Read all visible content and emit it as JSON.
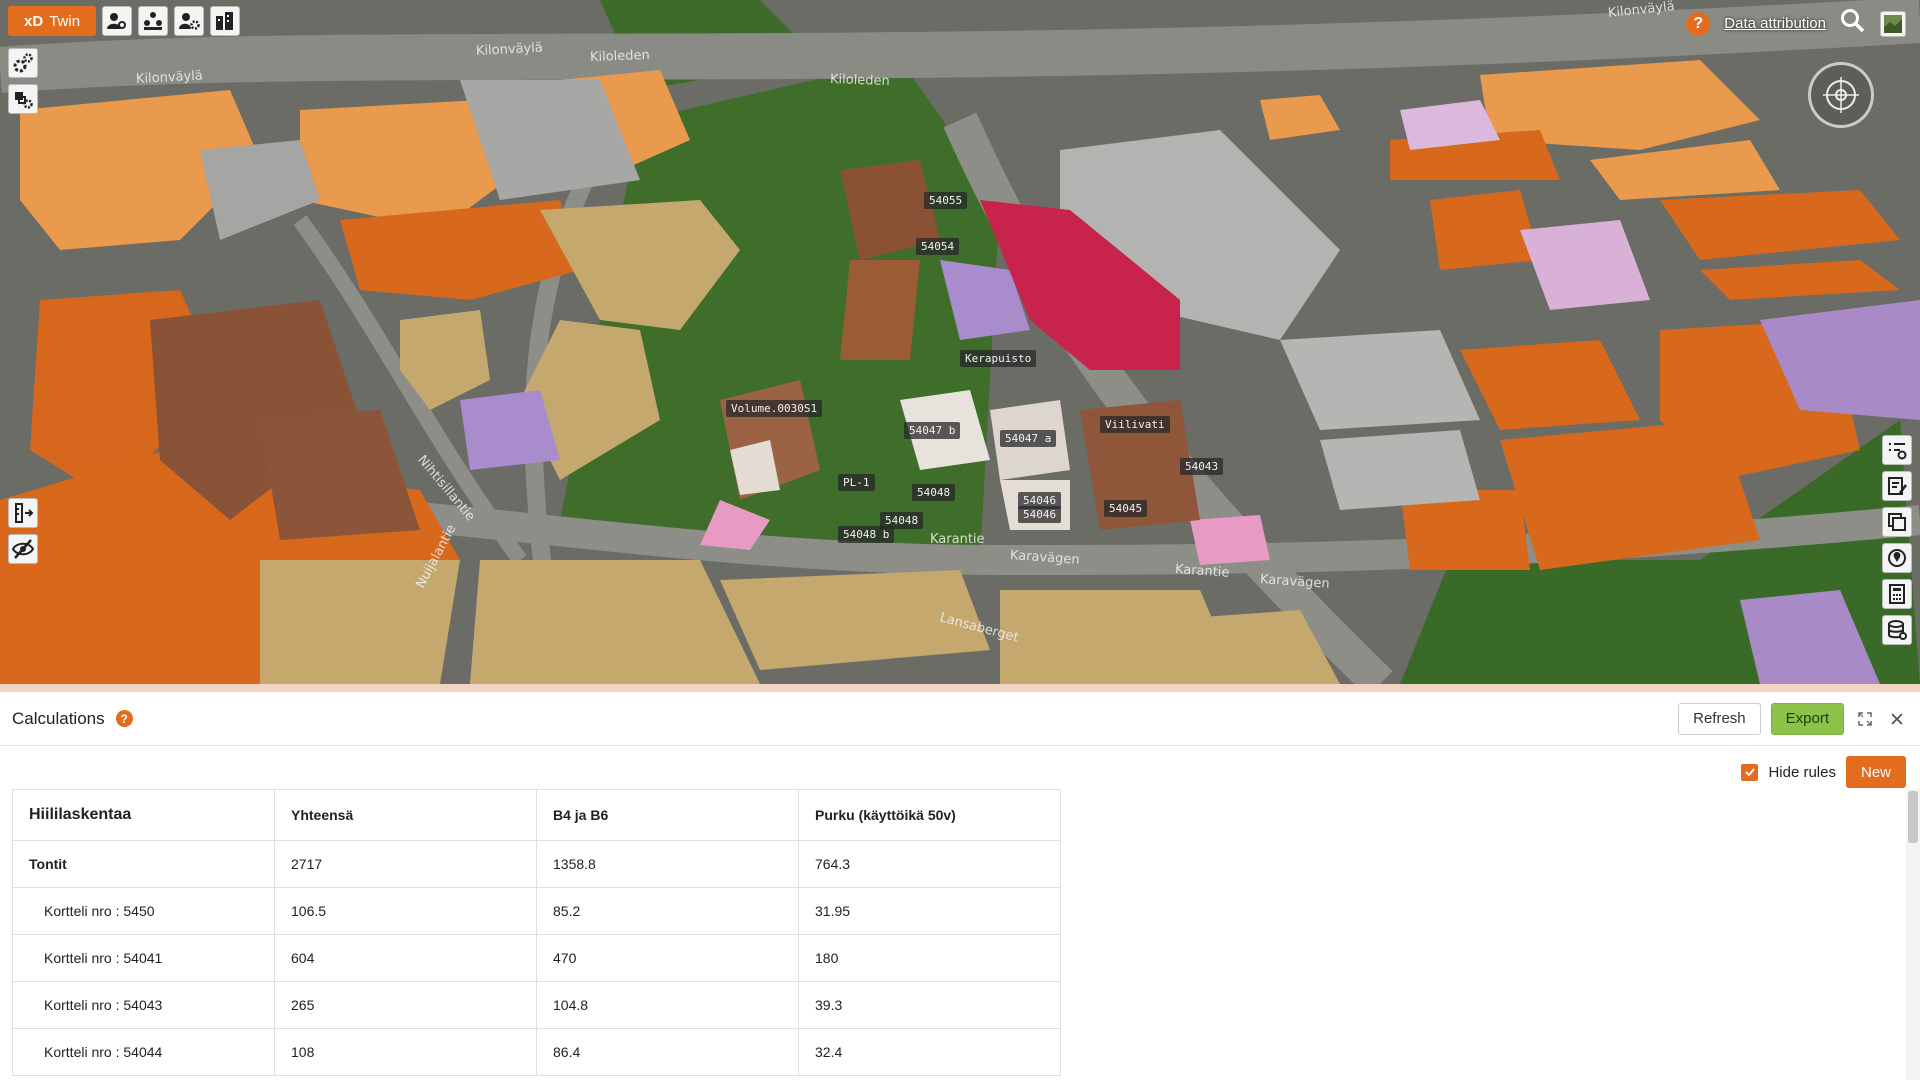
{
  "app": {
    "brand_primary": "xD",
    "brand_secondary": "Twin",
    "accent_color": "#e36c1f"
  },
  "toolbar": {
    "top_icons": [
      "users-settings-icon",
      "group-settings-icon",
      "user-gear-icon",
      "buildings-icon"
    ],
    "left_icons_top": [
      "settings-icon",
      "layers-settings-icon"
    ],
    "left_icons_mid": [
      "measure-icon",
      "visibility-off-icon"
    ],
    "right_icons": [
      "legend-list-icon",
      "notes-icon",
      "copy-layers-icon",
      "map-pin-icon",
      "calculator-icon",
      "database-icon"
    ]
  },
  "header_right": {
    "help": "?",
    "attribution": "Data attribution"
  },
  "map": {
    "labels": [
      "54055",
      "54054",
      "Kerapuisto",
      "Volume.0030S1",
      "54047 b",
      "54047 a",
      "Viilivati",
      "54043",
      "PL-1",
      "54048",
      "54048",
      "54048 b",
      "54046",
      "54046",
      "54045"
    ],
    "streets": [
      "Kilonväylä",
      "Kiloleden",
      "Kilonväylä",
      "Kiloleden",
      "Kilonväylä",
      "Karantie",
      "Karavägen",
      "Karantie",
      "Karavägen",
      "Nihtisillantie",
      "Nuijalantie",
      "Lansaberget"
    ]
  },
  "panel": {
    "title": "Calculations",
    "help": "?",
    "refresh_label": "Refresh",
    "export_label": "Export",
    "hide_rules_label": "Hide rules",
    "new_label": "New"
  },
  "table": {
    "headers": [
      "Hiililaskentaa",
      "Yhteensä",
      "B4 ja B6",
      "Purku (käyttöikä 50v)"
    ],
    "rows": [
      [
        "Tontit",
        "2717",
        "1358.8",
        "764.3"
      ],
      [
        "Kortteli nro : 5450",
        "106.5",
        "85.2",
        "31.95"
      ],
      [
        "Kortteli nro : 54041",
        "604",
        "470",
        "180"
      ],
      [
        "Kortteli nro : 54043",
        "265",
        "104.8",
        "39.3"
      ],
      [
        "Kortteli nro : 54044",
        "108",
        "86.4",
        "32.4"
      ]
    ]
  }
}
